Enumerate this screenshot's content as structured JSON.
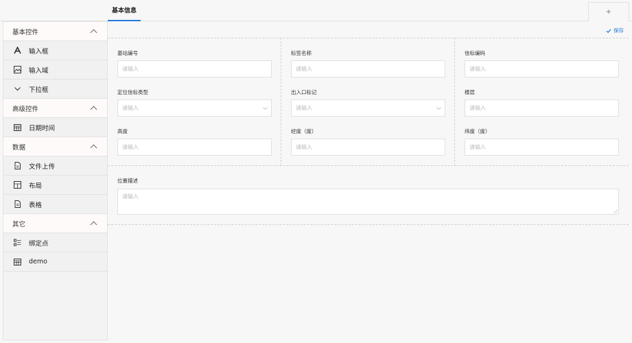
{
  "tabs": {
    "active_label": "基本信息",
    "add_label": "+"
  },
  "toolbar": {
    "save_label": "保存"
  },
  "sidebar": {
    "groups": [
      {
        "title": "基本控件",
        "items": [
          {
            "label": "输入框",
            "icon": "text-a-icon"
          },
          {
            "label": "输入域",
            "icon": "image-icon"
          },
          {
            "label": "下拉框",
            "icon": "chevron-down-icon"
          }
        ]
      },
      {
        "title": "高级控件",
        "items": [
          {
            "label": "日期时间",
            "icon": "calendar-icon"
          }
        ]
      },
      {
        "title": "数据",
        "items": [
          {
            "label": "文件上传",
            "icon": "file-icon"
          },
          {
            "label": "布局",
            "icon": "layout-icon"
          },
          {
            "label": "表格",
            "icon": "doc-icon"
          }
        ]
      },
      {
        "title": "其它",
        "items": [
          {
            "label": "绑定点",
            "icon": "bind-icon"
          },
          {
            "label": "demo",
            "icon": "table-icon"
          }
        ]
      }
    ]
  },
  "form": {
    "placeholder": "请输入",
    "fields": [
      {
        "label": "基站编号",
        "type": "input"
      },
      {
        "label": "标签名称",
        "type": "input"
      },
      {
        "label": "信标编码",
        "type": "input"
      },
      {
        "label": "定位信标类型",
        "type": "select"
      },
      {
        "label": "出入口标记",
        "type": "select"
      },
      {
        "label": "楼层",
        "type": "input"
      },
      {
        "label": "高度",
        "type": "input"
      },
      {
        "label": "经度（度）",
        "type": "input"
      },
      {
        "label": "纬度（度）",
        "type": "input"
      }
    ],
    "textarea": {
      "label": "位置描述",
      "placeholder": "请输入"
    }
  }
}
